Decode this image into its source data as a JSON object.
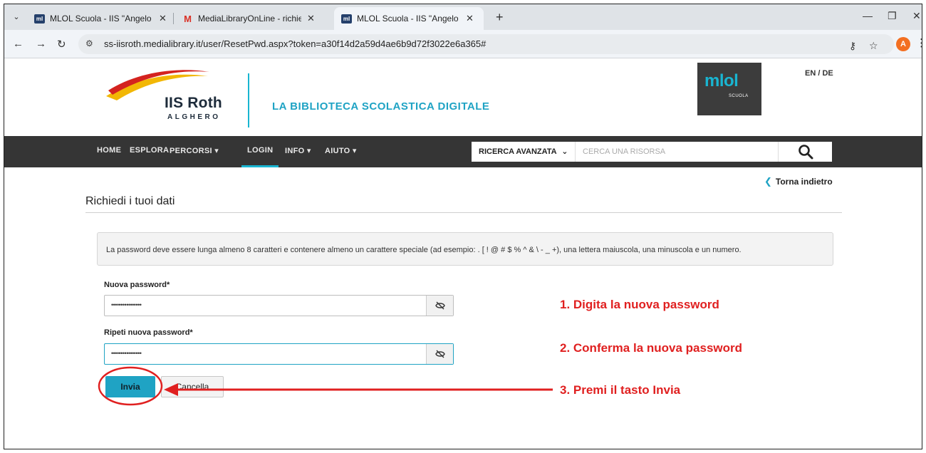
{
  "browser": {
    "tabs": [
      {
        "title": "MLOL Scuola - IIS \"Angelo Roth",
        "favicon": "ml"
      },
      {
        "title": "MediaLibraryOnLine - richiesta",
        "favicon": "M"
      },
      {
        "title": "MLOL Scuola - IIS \"Angelo Roth",
        "favicon": "ml"
      }
    ],
    "url": "ss-iisroth.medialibrary.it/user/ResetPwd.aspx?token=a30f14d2a59d4ae6b9d72f3022e6a365#",
    "profile_initial": "A"
  },
  "site": {
    "logo_name": "IIS Roth",
    "logo_city": "ALGHERO",
    "tagline": "LA BIBLIOTECA SCOLASTICA DIGITALE",
    "mlol_logo": "mlol",
    "mlol_sub": "SCUOLA",
    "lang": "EN / DE"
  },
  "nav": {
    "items": [
      "HOME",
      "ESPLORA",
      "PERCORSI ▾",
      "LOGIN",
      "INFO ▾",
      "AIUTO ▾"
    ],
    "active": "LOGIN",
    "search_mode": "RICERCA AVANZATA",
    "search_placeholder": "CERCA UNA RISORSA"
  },
  "page": {
    "back_link": "Torna indietro",
    "title": "Richiedi i tuoi dati",
    "info": "La password deve essere lunga almeno 8 caratteri e contenere almeno un carattere speciale (ad esempio: . [ ! @ # $ % ^ & \\ - _ +), una lettera maiuscola, una minuscola e un numero.",
    "new_password_label": "Nuova password*",
    "new_password_value": "••••••••••••••••",
    "repeat_password_label": "Ripeti nuova password*",
    "repeat_password_value": "••••••••••••••••",
    "submit_label": "Invia",
    "cancel_label": "Cancella"
  },
  "annotations": {
    "step1": "1. Digita la nuova password",
    "step2": "2. Conferma la nuova password",
    "step3": "3. Premi il tasto Invia",
    "color": "#e02020"
  },
  "colors": {
    "accent": "#1fa3c4",
    "nav_bg": "#353535",
    "annotation": "#e02020"
  }
}
